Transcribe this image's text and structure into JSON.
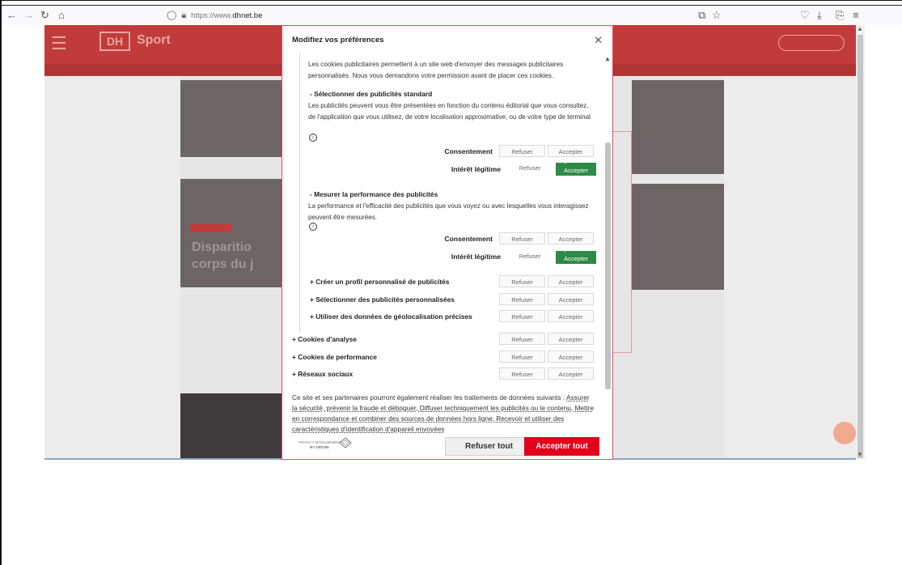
{
  "browser": {
    "url_prefix": "https://www.",
    "url_host": "dhnet.be",
    "icons": [
      "back-icon",
      "forward-icon",
      "reload-icon",
      "home-icon",
      "shield-icon",
      "lock-icon",
      "translate-icon",
      "star-icon",
      "pocket-icon",
      "download-icon",
      "extensions-icon",
      "menu-icon"
    ]
  },
  "site": {
    "logo": "DH",
    "section": "Sport",
    "ghost_headline_1": "Disparitio",
    "ghost_headline_2": "corps du j"
  },
  "modal": {
    "title": "Modifiez vos préférences",
    "intro": "Les cookies publicitaires permettent à un site web d'envoyer des messages publicitaires personnalisés. Nous vous demandons votre permission avant de placer ces cookies.",
    "sections": [
      {
        "heading": "- Sélectionner des publicités standard",
        "text": "Les publicités peuvent vous être présentées en fonction du contenu éditorial que vous consultez, de l'application que vous utilisez, de votre localisation approximative, ou de votre type de terminal"
      },
      {
        "heading": "- Mesurer la performance des publicités",
        "text": "La performance et l'efficacité des publicités que vous voyez ou avec lesquelles vous interagissez peuvent être mesurées."
      }
    ],
    "consent_label": "Consentement",
    "legit_label": "Intérêt légitime",
    "refuse_label": "Refuser",
    "accept_label": "Accepter",
    "sub_purposes": [
      "+ Créer un profil personnalisé de publicités",
      "+ Sélectionner des publicités personnalisées",
      "+ Utiliser des données de géolocalisation précises"
    ],
    "categories": [
      "+ Cookies d'analyse",
      "+ Cookies de performance",
      "+ Réseaux sociaux"
    ],
    "footer": {
      "lead": "Ce site et ses partenaires pourront également réaliser les traitements de données suivants :",
      "links": "Assurer la sécurité, prévenir la fraude et déboguer, Diffuser techniquement les publicités ou le contenu, Mettre en correspondance et combiner des sources de données hors ligne, Recevoir et utiliser des caractéristiques d'identification d'appareil envoyées"
    },
    "powered_by_1": "PRIVACY MANAGEMENT",
    "powered_by_2": "BY DIDOMI",
    "refuse_all": "Refuser tout",
    "accept_all": "Accepter tout"
  },
  "colors": {
    "accent_red": "#e3001b",
    "accept_green": "#2e8a46",
    "header_red": "#c23b3b"
  }
}
